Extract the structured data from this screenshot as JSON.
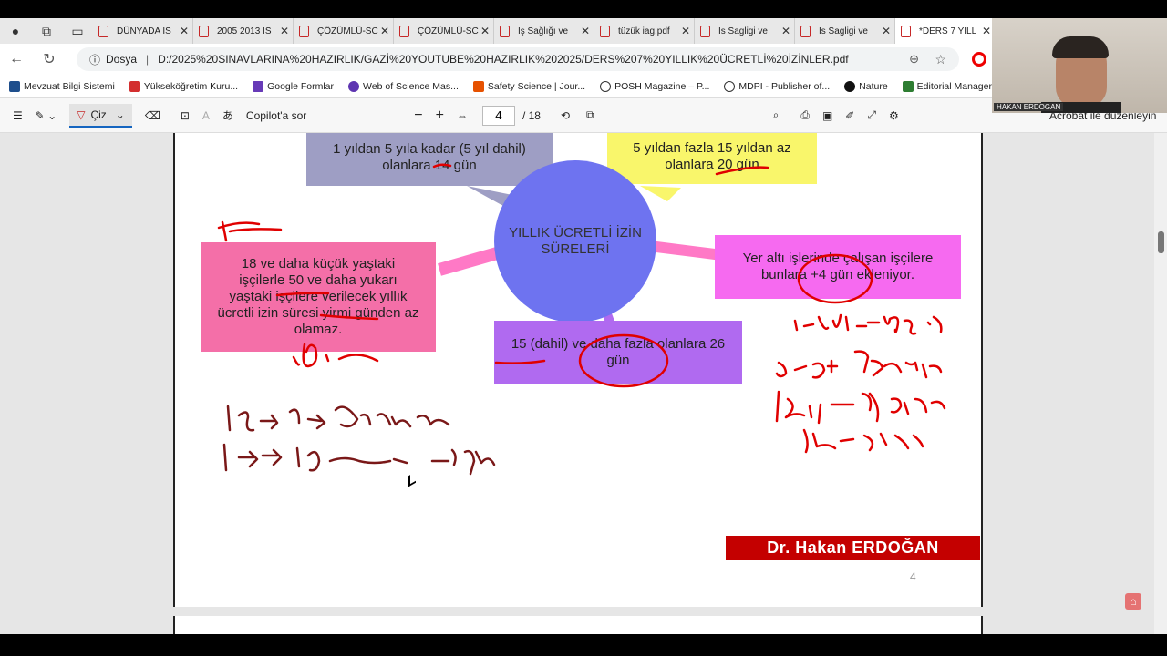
{
  "tabs": [
    {
      "label": "DÜNYADA İS"
    },
    {
      "label": "2005 2013 İS"
    },
    {
      "label": "ÇÖZÜMLÜ-SC"
    },
    {
      "label": "ÇÖZÜMLÜ-SC"
    },
    {
      "label": "İş Sağlığı ve"
    },
    {
      "label": "tüzük iag.pdf"
    },
    {
      "label": "Is Sagligi ve"
    },
    {
      "label": "Is Sagligi ve"
    },
    {
      "label": "*DERS 7 YILL"
    }
  ],
  "address": {
    "scheme_label": "Dosya",
    "url": "D:/2025%20SINAVLARINA%20HAZIRLIK/GAZİ%20YOUTUBE%20HAZIRLIK%202025/DERS%207%20YILLIK%20ÜCRETLİ%20İZİNLER.pdf"
  },
  "bookmarks": [
    {
      "label": "Mevzuat Bilgi Sistemi",
      "color": "#1e4e8c"
    },
    {
      "label": "Yükseköğretim Kuru...",
      "color": "#d32f2f"
    },
    {
      "label": "Google Formlar",
      "color": "#673ab7"
    },
    {
      "label": "Web of Science Mas...",
      "color": "#5e35b1"
    },
    {
      "label": "Safety Science | Jour...",
      "color": "#e65100"
    },
    {
      "label": "POSH Magazine – P...",
      "color": "#333333"
    },
    {
      "label": "MDPI - Publisher of...",
      "color": "#333333"
    },
    {
      "label": "Nature",
      "color": "#111111"
    },
    {
      "label": "Editorial Manager®",
      "color": "#2e7d32"
    }
  ],
  "pdf_toolbar": {
    "draw_label": "Çiz",
    "copilot_label": "Copilot'a sor",
    "page_current": "4",
    "page_total": "/ 18",
    "acrobat_label": "Acrobat ile düzenleyin"
  },
  "slide": {
    "center": "YILLIK ÜCRETLİ İZİN SÜRELERİ",
    "box_top_left": "1 yıldan 5 yıla kadar (5 yıl dahil) olanlara 14 gün",
    "box_top_right": "5 yıldan fazla 15 yıldan az olanlara 20 gün",
    "box_left": "18 ve daha küçük yaştaki işçilerle 50 ve daha yukarı yaştaki işçilere verilecek yıllık ücretli izin süresi yirmi günden az olamaz.",
    "box_right": "Yer altı işlerinde çalışan işçilere bunlara +4 gün ekleniyor.",
    "box_bottom": "15 (dahil) ve daha fazla olanlara 26 gün",
    "author": "Dr. Hakan ERDOĞAN",
    "page_number": "4"
  },
  "webcam": {
    "name": "HAKAN ERDOGAN"
  }
}
